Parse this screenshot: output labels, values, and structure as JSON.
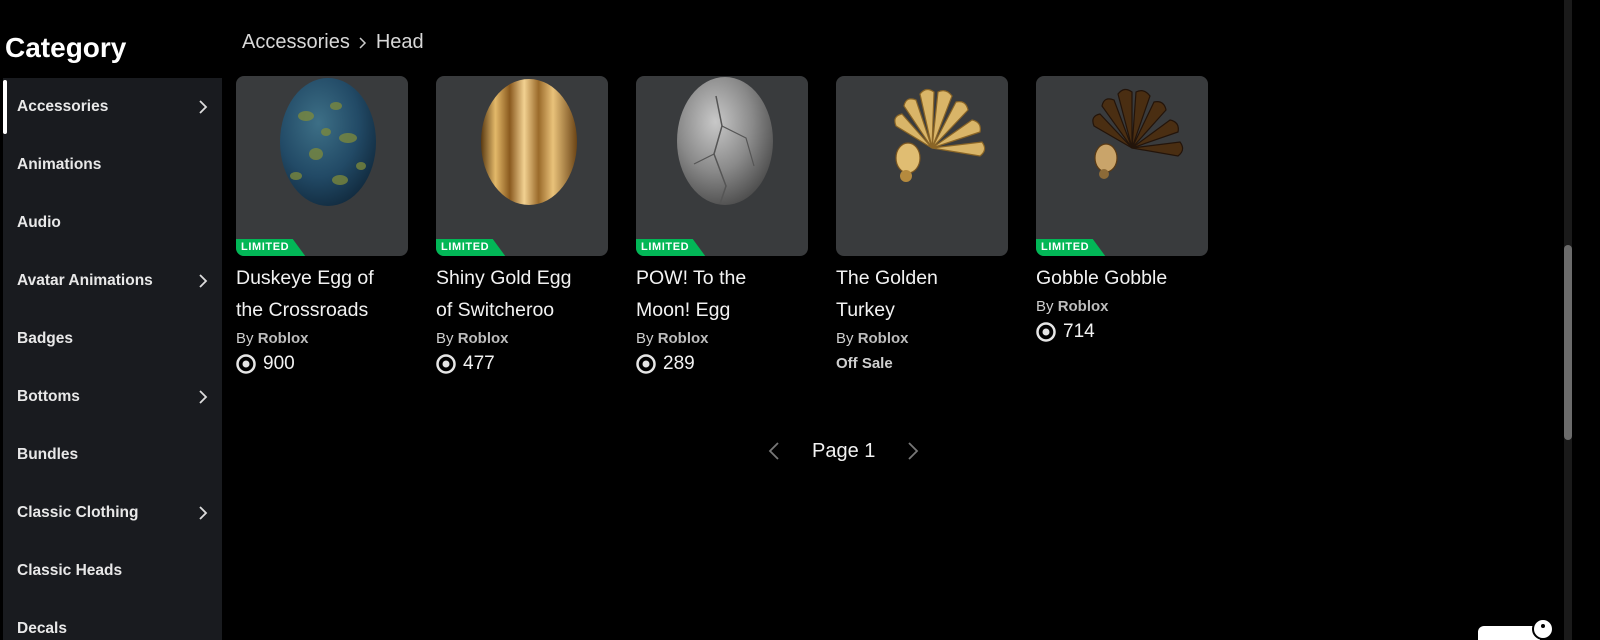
{
  "sidebar": {
    "title": "Category",
    "items": [
      {
        "label": "Accessories",
        "has_submenu": true,
        "active": true
      },
      {
        "label": "Animations",
        "has_submenu": false
      },
      {
        "label": "Audio",
        "has_submenu": false
      },
      {
        "label": "Avatar Animations",
        "has_submenu": true
      },
      {
        "label": "Badges",
        "has_submenu": false
      },
      {
        "label": "Bottoms",
        "has_submenu": true
      },
      {
        "label": "Bundles",
        "has_submenu": false
      },
      {
        "label": "Classic Clothing",
        "has_submenu": true
      },
      {
        "label": "Classic Heads",
        "has_submenu": false
      },
      {
        "label": "Decals",
        "has_submenu": false
      }
    ]
  },
  "breadcrumb": {
    "parent": "Accessories",
    "current": "Head"
  },
  "items": [
    {
      "name_line1": "Duskeye Egg of",
      "name_line2": "the Crossroads",
      "by": "By",
      "creator": "Roblox",
      "price": "900",
      "limited": true,
      "limited_label": "LIMITED",
      "thumb": "blue-egg"
    },
    {
      "name_line1": "Shiny Gold Egg",
      "name_line2": "of Switcheroo",
      "by": "By",
      "creator": "Roblox",
      "price": "477",
      "limited": true,
      "limited_label": "LIMITED",
      "thumb": "gold-egg"
    },
    {
      "name_line1": "POW! To the",
      "name_line2": "Moon! Egg",
      "by": "By",
      "creator": "Roblox",
      "price": "289",
      "limited": true,
      "limited_label": "LIMITED",
      "thumb": "stone-egg"
    },
    {
      "name_line1": "The Golden",
      "name_line2": "Turkey",
      "by": "By",
      "creator": "Roblox",
      "status": "Off Sale",
      "limited": false,
      "thumb": "golden-turkey"
    },
    {
      "name_line1": "Gobble Gobble",
      "name_line2": "",
      "by": "By",
      "creator": "Roblox",
      "price": "714",
      "limited": true,
      "limited_label": "LIMITED",
      "thumb": "brown-turkey"
    }
  ],
  "pagination": {
    "label": "Page 1"
  },
  "colors": {
    "background": "#000000",
    "sidebar_bg": "#191b1f",
    "card_bg": "#393b3d",
    "limited_green": "#02b757"
  },
  "icons": {
    "chevron": "chevron-right-icon",
    "currency": "robux-icon",
    "prev": "chevron-left-icon",
    "next": "chevron-right-icon"
  }
}
